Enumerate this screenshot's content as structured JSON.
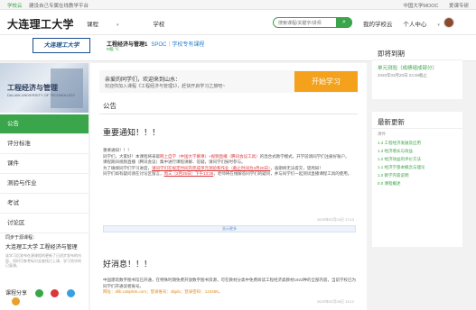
{
  "topbar": {
    "left": [
      "学校云",
      "建设自己专属在线教学平台"
    ],
    "right": [
      "中国大学MOOC",
      "爱课专研"
    ]
  },
  "header": {
    "title": "大连理工大学",
    "nav": [
      {
        "label": "课程",
        "caret": "▾"
      },
      {
        "label": "学校"
      }
    ],
    "search_placeholder": "搜索课程/关键字/讲师",
    "search_icon": "search-icon",
    "right_links": [
      "我的学校云",
      "个人中心"
    ],
    "caret": "▾"
  },
  "course": {
    "logo_text": "大连理工大学",
    "title": "工程经济与管理1",
    "spoc": "SPOC｜学校专有课程",
    "sub": "R級 ℃"
  },
  "cover": {
    "text": "工程经济与管理",
    "sub": "DALIAN UNIVERSITY OF TECHNOLOGY"
  },
  "sidebar": {
    "items": [
      {
        "label": "公告",
        "active": true
      },
      {
        "label": "评分标准"
      },
      {
        "label": "课件"
      },
      {
        "label": "测验与作业"
      },
      {
        "label": "考试"
      },
      {
        "label": "讨论区"
      }
    ],
    "from_heading": "同步于源课程：",
    "from_title": "大连理工大学 工程经济与管理",
    "from_desc": "该学习后发布在源课程的更新了已初步发布的内容，同时可参考标识去查找已上课，学习完毕的已复课。",
    "share_label": "课程分享",
    "share_colors": [
      "#3aa54a",
      "#d9373a",
      "#39a0e0",
      "#e8a02a"
    ]
  },
  "main": {
    "welcome_line1": "亲爱的同学们，欢迎来到山水：",
    "welcome_line2": "欢迎你加入课程《工程经济与管理1》，赶快开启学习之旅吧~",
    "start_button": "开始学习",
    "section_title": "公告",
    "notice1": {
      "title": "重要通知！！！",
      "p1": "重要通知！！！",
      "p2a": "同学们，大家好！本课程将采取",
      "p2red": "网上自学（中国大学慕课）+视频直播（腾讯会议工具）",
      "p2b": "的混合式教学模式，开学前请同学们注册好账户。",
      "p3": "课程期间视频直播（腾讯会议）集中进行课程讲解、答疑，请同学们按时参与。",
      "p4a": "为了确保同学们学习进度，",
      "p4red": "请同学们在规定时间内完成单元测验和作业（截止时间为3月20日）",
      "p4b": "，逾期将无法提交，望周知！",
      "p5a": "同学们如有疑问请在讨论区留言，",
      "p5red": "周三（2月25日）下午13:35",
      "p5b": "，老师将在线解答同学们的疑问，并与同学们一起测试直播课程工具的使用。",
      "time": "2020年02月24日 17:13"
    },
    "expand_label": "显示更多",
    "notice2": {
      "title": "好消息！！！",
      "p1": "中国建筑数字图书馆已开通，在特殊时期免费开放数字图书资源，可在教材分类中免费阅读工程经济类教材1923种的全部内容，当前学校已为同学们开通读者账号。",
      "link": "网址：dlib.cabplink.com；登录账号：dlgdx；登录密码：123456。",
      "time": "2020年02月28日 13:12"
    }
  },
  "right": {
    "upcoming_title": "即将到期",
    "upcoming_item": "单元测验（成绩组成部分）",
    "upcoming_date": "2020年03月20日 23:30截止",
    "updates_title": "最新更新",
    "updates_category": "课件",
    "updates": [
      "1.4 工程经济发展及应用",
      "1.3 经济增长与效益",
      "1.2 经济效益的评价方法",
      "1.1 经济学基本概念与理论",
      "1.0 教学内容说明",
      "0.0 课程概述"
    ]
  }
}
